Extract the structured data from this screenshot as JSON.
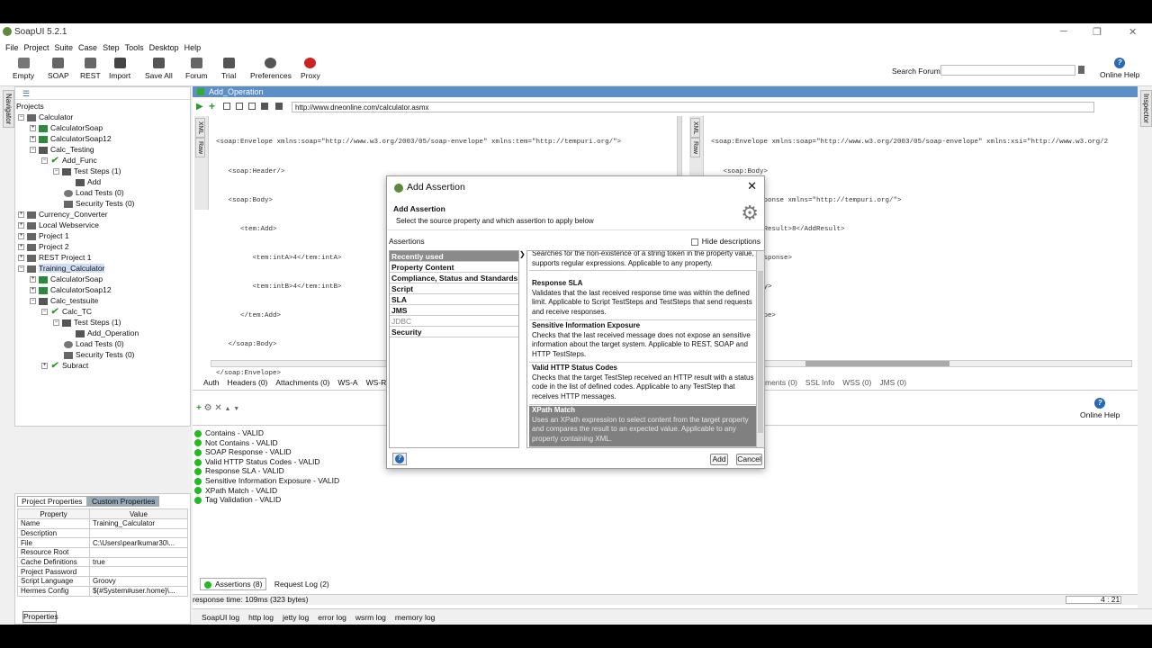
{
  "app": {
    "title": "SoapUI 5.2.1"
  },
  "menu": [
    "File",
    "Project",
    "Suite",
    "Case",
    "Step",
    "Tools",
    "Desktop",
    "Help"
  ],
  "toolbar": {
    "buttons": [
      {
        "label": "Empty",
        "icon": "empty-project-icon"
      },
      {
        "label": "SOAP",
        "icon": "soap-project-icon"
      },
      {
        "label": "REST",
        "icon": "rest-project-icon"
      },
      {
        "label": "Import",
        "icon": "import-icon"
      },
      {
        "label": "Save All",
        "icon": "save-all-icon"
      },
      {
        "label": "Forum",
        "icon": "forum-icon"
      },
      {
        "label": "Trial",
        "icon": "trial-icon"
      },
      {
        "label": "Preferences",
        "icon": "preferences-icon"
      },
      {
        "label": "Proxy",
        "icon": "proxy-icon"
      }
    ],
    "search_label": "Search Forum",
    "search_value": "",
    "online_help": "Online Help"
  },
  "sidebar_tabs": {
    "navigator": "Navigator",
    "inspector": "Inspector"
  },
  "tree": {
    "root": "Projects",
    "rows": [
      {
        "label": "Calculator"
      },
      {
        "label": "CalculatorSoap"
      },
      {
        "label": "CalculatorSoap12"
      },
      {
        "label": "Calc_Testing"
      },
      {
        "label": "Add_Func"
      },
      {
        "label": "Test Steps (1)"
      },
      {
        "label": "Add"
      },
      {
        "label": "Load Tests (0)"
      },
      {
        "label": "Security Tests (0)"
      },
      {
        "label": "Currency_Converter"
      },
      {
        "label": "Local Webservice"
      },
      {
        "label": "Project 1"
      },
      {
        "label": "Project 2"
      },
      {
        "label": "REST Project 1"
      },
      {
        "label": "Training_Calculator"
      },
      {
        "label": "CalculatorSoap"
      },
      {
        "label": "CalculatorSoap12"
      },
      {
        "label": "Calc_testsuite"
      },
      {
        "label": "Calc_TC"
      },
      {
        "label": "Test Steps (1)"
      },
      {
        "label": "Add_Operation"
      },
      {
        "label": "Load Tests (0)"
      },
      {
        "label": "Security Tests (0)"
      },
      {
        "label": "Subract"
      }
    ]
  },
  "properties": {
    "tabs": [
      "Project Properties",
      "Custom Properties"
    ],
    "headers": [
      "Property",
      "Value"
    ],
    "rows": [
      [
        "Name",
        "Training_Calculator"
      ],
      [
        "Description",
        ""
      ],
      [
        "File",
        "C:\\Users\\pearlkumar30\\..."
      ],
      [
        "Resource Root",
        ""
      ],
      [
        "Cache Definitions",
        "true"
      ],
      [
        "Project Password",
        ""
      ],
      [
        "Script Language",
        "Groovy"
      ],
      [
        "Hermes Config",
        "${#System#user.home}\\..."
      ]
    ],
    "bottom_button": "Properties"
  },
  "editor": {
    "title": "Add_Operation",
    "url": "http://www.dneonline.com/calculator.asmx",
    "request_xml": [
      "<soap:Envelope xmlns:soap=\"http://www.w3.org/2003/05/soap-envelope\" xmlns:tem=\"http://tempuri.org/\">",
      "   <soap:Header/>",
      "   <soap:Body>",
      "      <tem:Add>",
      "         <tem:intA>4</tem:intA>",
      "         <tem:intB>4</tem:intB>",
      "      </tem:Add>",
      "   </soap:Body>",
      "</soap:Envelope>"
    ],
    "response_xml": [
      "<soap:Envelope xmlns:soap=\"http://www.w3.org/2003/05/soap-envelope\" xmlns:xsi=\"http://www.w3.org/2",
      "   <soap:Body>",
      "      <AddResponse xmlns=\"http://tempuri.org/\">",
      "         <AddResult>8</AddResult>",
      "      </AddResponse>",
      "   </soap:Body>",
      "</soap:Envelope>"
    ],
    "gutter_labels": [
      "XML",
      "Raw"
    ],
    "request_tabs": [
      "Auth",
      "Headers (0)",
      "Attachments (0)",
      "WS-A",
      "WS-RM"
    ],
    "response_tabs": [
      "ments (0)",
      "SSL Info",
      "WSS (0)",
      "JMS (0)"
    ],
    "online_help": "Online Help",
    "assertions": [
      "Contains - VALID",
      "Not Contains - VALID",
      "SOAP Response - VALID",
      "Valid HTTP Status Codes - VALID",
      "Response SLA - VALID",
      "Sensitive Information Exposure - VALID",
      "XPath Match - VALID",
      "Tag Validation - VALID"
    ],
    "bottom_tabs": [
      "Assertions (8)",
      "Request Log (2)"
    ],
    "response_time": "response time: 109ms (323 bytes)",
    "position": "4 : 21"
  },
  "dialog": {
    "title": "Add Assertion",
    "header": "Add Assertion",
    "subheader": "Select the source property and which assertion to apply below",
    "assertions_label": "Assertions",
    "hide_descriptions": "Hide descriptions",
    "categories": [
      "Recently used",
      "Property Content",
      "Compliance, Status and Standards",
      "Script",
      "SLA",
      "JMS",
      "JDBC",
      "Security"
    ],
    "items": [
      {
        "name": "",
        "desc": "Searches for the non-existence of a string token in the property value, supports regular expressions. Applicable to any property."
      },
      {
        "name": "Response SLA",
        "desc": "Validates that the last received response time was within the defined limit. Applicable to Script TestSteps and TestSteps that send requests and receive responses."
      },
      {
        "name": "Sensitive Information Exposure",
        "desc": "Checks that the last received message does not expose an sensitive information about the target system. Applicable to REST, SOAP and HTTP TestSteps."
      },
      {
        "name": "Valid HTTP Status Codes",
        "desc": "Checks that the target TestStep received an HTTP result with a status code in the list of defined codes. Applicable to any TestStep that receives HTTP messages."
      },
      {
        "name": "XPath Match",
        "desc": "Uses an XPath expression to select content from the target property and compares the result to an expected value. Applicable to any property containing XML."
      }
    ],
    "add": "Add",
    "cancel": "Cancel"
  },
  "logs": [
    "SoapUI log",
    "http log",
    "jetty log",
    "error log",
    "wsrm log",
    "memory log"
  ]
}
